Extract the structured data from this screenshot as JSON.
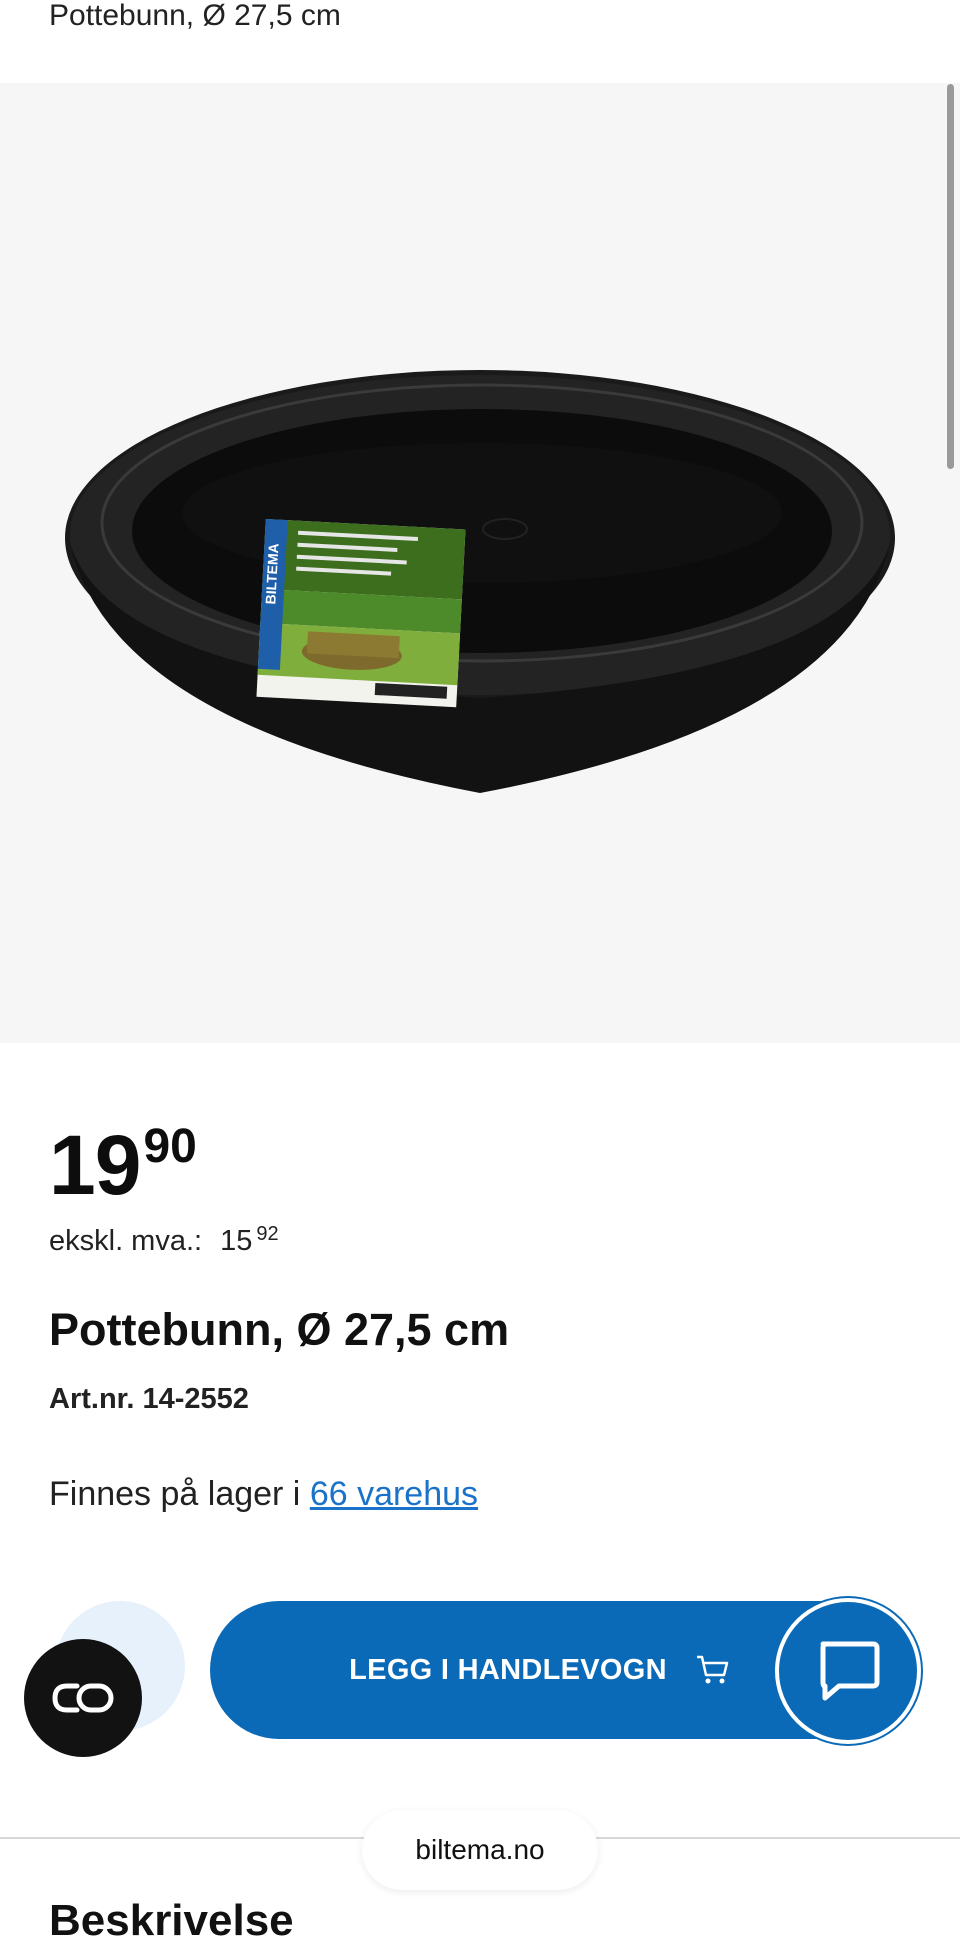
{
  "header": {
    "title": "Pottebunn, Ø 27,5 cm"
  },
  "product": {
    "price_int": "19",
    "price_dec": "90",
    "vat_label": "ekskl. mva.:",
    "vat_int": "15",
    "vat_dec": "92",
    "title": "Pottebunn, Ø 27,5 cm",
    "art_nr": "Art.nr. 14-2552",
    "stock_text": "Finnes på lager i ",
    "stock_link": "66 varehus",
    "package_brand": "BILTEMA"
  },
  "actions": {
    "add_to_cart": "LEGG I HANDLEVOGN",
    "chat_icon": "chat-bubble-icon",
    "co_icon": "co-link-icon",
    "cart_icon": "cart-icon"
  },
  "browser": {
    "url": "biltema.no"
  },
  "next_section": {
    "heading": "Beskrivelse"
  },
  "colors": {
    "accent": "#0a6ab8",
    "link": "#1a73c8",
    "gallery_bg": "#f6f6f6"
  }
}
